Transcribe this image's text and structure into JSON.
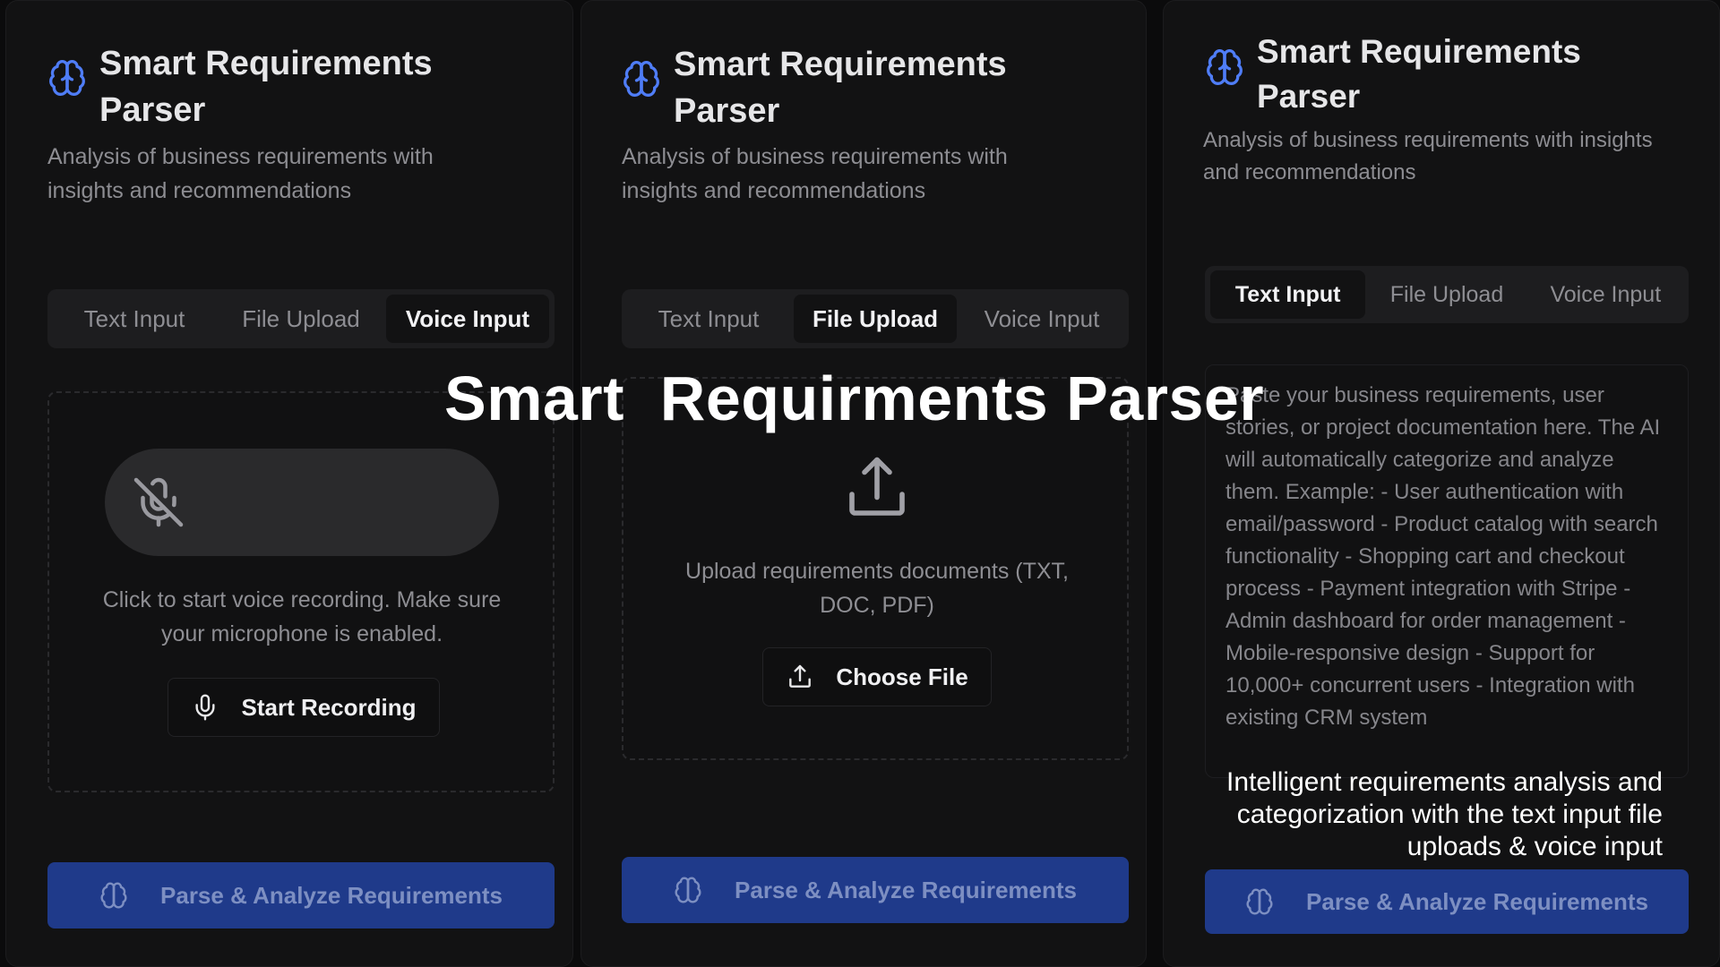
{
  "panels": [
    {
      "title_line1": "Smart Requirements",
      "title_line2": "Parser",
      "subtitle": "Analysis of business requirements with insights and recommendations",
      "tabs": [
        "Text Input",
        "File Upload",
        "Voice Input"
      ],
      "active_tab": "Voice Input",
      "help_text": "Click to start voice recording. Make sure your microphone is enabled.",
      "action_label": "Start Recording",
      "primary_label": "Parse & Analyze Requirements"
    },
    {
      "title_line1": "Smart Requirements",
      "title_line2": "Parser",
      "subtitle": "Analysis of business requirements with insights and recommendations",
      "tabs": [
        "Text Input",
        "File Upload",
        "Voice Input"
      ],
      "active_tab": "File Upload",
      "help_text": "Upload requirements documents (TXT, DOC, PDF)",
      "action_label": "Choose File",
      "primary_label": "Parse & Analyze Requirements"
    },
    {
      "title_line1": "Smart Requirements",
      "title_line2": "Parser",
      "subtitle": "Analysis of business requirements with insights and recommendations",
      "tabs": [
        "Text Input",
        "File Upload",
        "Voice Input"
      ],
      "active_tab": "Text Input",
      "placeholder": "Paste your business requirements, user stories, or project documentation here. The AI will automatically categorize and analyze them.  Example: - User authentication with email/password - Product catalog with search functionality - Shopping cart and checkout process - Payment integration with Stripe - Admin dashboard for order management - Mobile-responsive design - Support for 10,000+ concurrent users - Integration with existing CRM system",
      "primary_label": "Parse & Analyze Requirements"
    }
  ],
  "overlay": {
    "title": "Smart  Requirments Parser",
    "caption": "Intelligent requirements analysis and categorization with the text input file uploads & voice input"
  },
  "colors": {
    "background": "#0b0b0c",
    "panel": "#121213",
    "accent_blue": "#4f7df7",
    "primary_button": "#1f3a8a"
  },
  "icons": {
    "brain": "brain-icon",
    "mic_off": "mic-off-icon",
    "mic": "mic-icon",
    "upload": "upload-icon"
  }
}
